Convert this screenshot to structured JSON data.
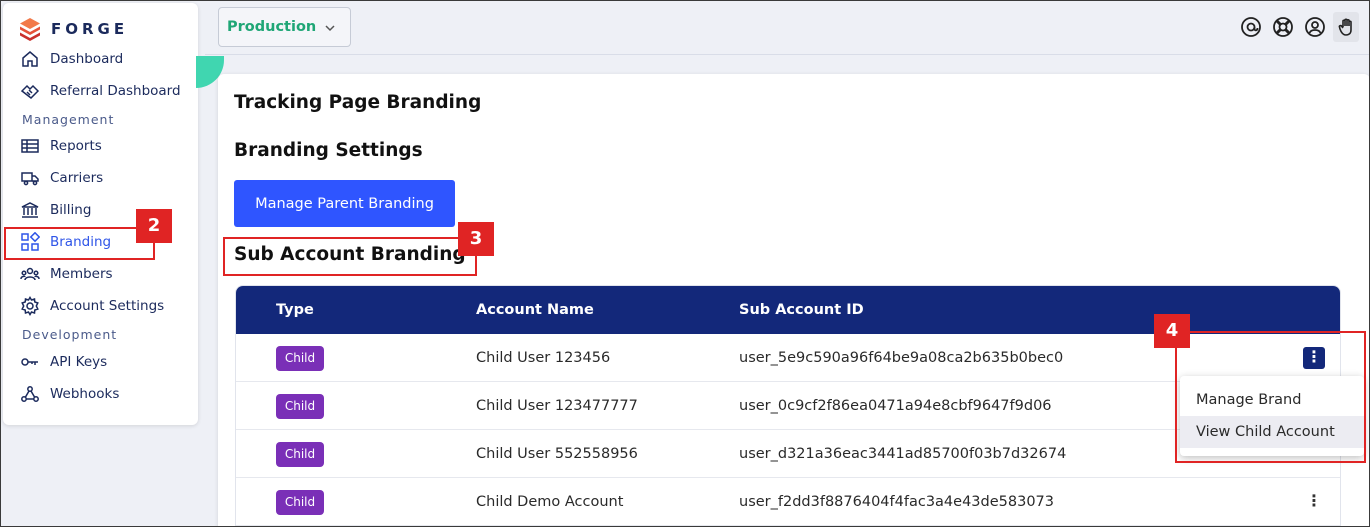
{
  "brand": {
    "name": "FORGE"
  },
  "sidebar": {
    "items": [
      {
        "label": "Dashboard",
        "icon": "home-icon"
      },
      {
        "label": "Referral Dashboard",
        "icon": "handshake-icon"
      },
      {
        "label": "Reports",
        "icon": "table-icon"
      },
      {
        "label": "Carriers",
        "icon": "truck-icon"
      },
      {
        "label": "Billing",
        "icon": "bank-icon"
      },
      {
        "label": "Branding",
        "icon": "grid-icon",
        "active": true
      },
      {
        "label": "Members",
        "icon": "people-icon"
      },
      {
        "label": "Account Settings",
        "icon": "gear-icon"
      },
      {
        "label": "API Keys",
        "icon": "key-icon"
      },
      {
        "label": "Webhooks",
        "icon": "webhook-icon"
      }
    ],
    "sections": {
      "management": "Management",
      "development": "Development"
    }
  },
  "topbar": {
    "environment": "Production",
    "icons": [
      "at-sign-icon",
      "lifebuoy-icon",
      "user-icon",
      "hand-icon"
    ]
  },
  "page": {
    "title": "Tracking Page Branding",
    "branding_settings": "Branding Settings",
    "manage_parent_button": "Manage Parent Branding",
    "sub_account_heading": "Sub Account Branding"
  },
  "table": {
    "headers": [
      "Type",
      "Account Name",
      "Sub Account ID"
    ],
    "rows": [
      {
        "type": "Child",
        "name": "Child User 123456",
        "id": "user_5e9c590a96f64be9a08ca2b635b0bec0"
      },
      {
        "type": "Child",
        "name": "Child User 123477777",
        "id": "user_0c9cf2f86ea0471a94e8cbf9647f9d06"
      },
      {
        "type": "Child",
        "name": "Child User 552558956",
        "id": "user_d321a36eac3441ad85700f03b7d32674"
      },
      {
        "type": "Child",
        "name": "Child Demo Account",
        "id": "user_f2dd3f8876404f4fac3a4e43de583073"
      }
    ]
  },
  "menu": {
    "items": [
      "Manage Brand",
      "View Child Account"
    ]
  },
  "annotations": {
    "a2": "2",
    "a3": "3",
    "a4": "4"
  },
  "kebab": "⋮",
  "colors": {
    "accent": "#2f55ff",
    "header": "#13287a",
    "badge": "#7a2fb7",
    "env": "#1fa676",
    "annotation": "#e02424"
  }
}
